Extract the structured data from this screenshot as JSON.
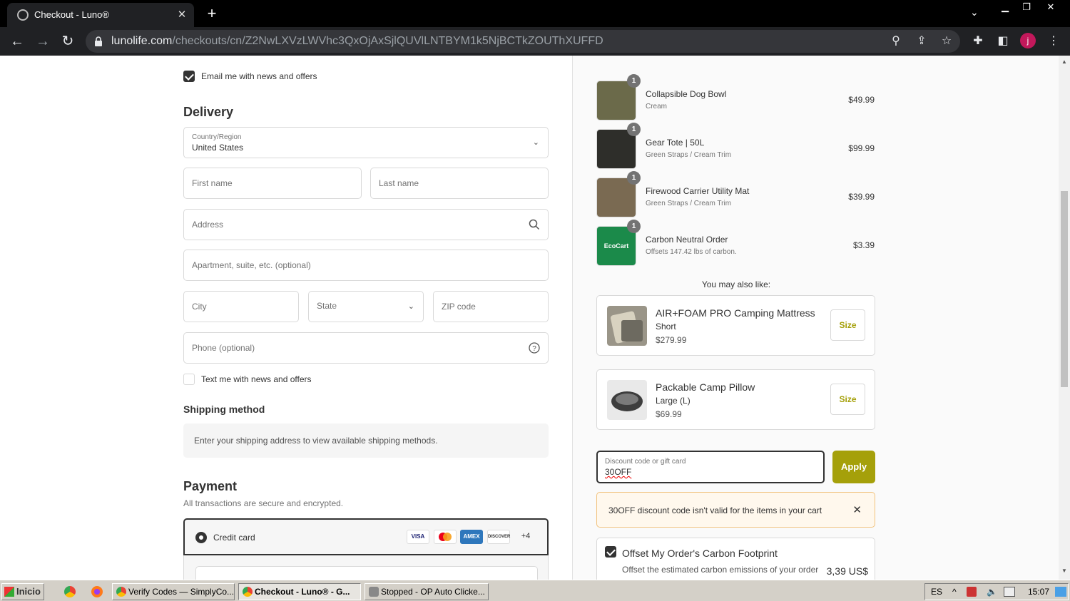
{
  "browser": {
    "tab_title": "Checkout - Luno®",
    "url_domain": "lunolife.com",
    "url_path": "/checkouts/cn/Z2NwLXVzLWVhc3QxOjAxSjlQUVlLNTBYM1k5NjBCTkZOUThXUFFD",
    "profile_initial": "j"
  },
  "contact": {
    "email_opt_in_label": "Email me with news and offers",
    "email_opt_in_checked": true
  },
  "delivery": {
    "title": "Delivery",
    "country_label": "Country/Region",
    "country_value": "United States",
    "first_name_placeholder": "First name",
    "last_name_placeholder": "Last name",
    "address_placeholder": "Address",
    "apartment_placeholder": "Apartment, suite, etc. (optional)",
    "city_placeholder": "City",
    "state_placeholder": "State",
    "zip_placeholder": "ZIP code",
    "phone_placeholder": "Phone (optional)",
    "sms_opt_in_label": "Text me with news and offers",
    "sms_opt_in_checked": false
  },
  "shipping": {
    "title": "Shipping method",
    "message": "Enter your shipping address to view available shipping methods."
  },
  "payment": {
    "title": "Payment",
    "subtitle": "All transactions are secure and encrypted.",
    "method_label": "Credit card",
    "card_brands": [
      "VISA",
      "MC",
      "AMEX",
      "DISCOVER"
    ],
    "more_brands": "+4"
  },
  "order": {
    "items": [
      {
        "qty": "1",
        "name": "Collapsible Dog Bowl",
        "variant": "Cream",
        "price": "$49.99",
        "thumb_color": "#6b6a4a"
      },
      {
        "qty": "1",
        "name": "Gear Tote | 50L",
        "variant": "Green Straps / Cream Trim",
        "price": "$99.99",
        "thumb_color": "#2e2e2a"
      },
      {
        "qty": "1",
        "name": "Firewood Carrier Utility Mat",
        "variant": "Green Straps / Cream Trim",
        "price": "$39.99",
        "thumb_color": "#7a6a52"
      },
      {
        "qty": "1",
        "name": "Carbon Neutral Order",
        "variant": "Offsets 147.42 lbs of carbon.",
        "price": "$3.39",
        "thumb_color": "#1b8a4a",
        "thumb_text": "EcoCart"
      }
    ],
    "upsell_heading": "You may also like:",
    "upsells": [
      {
        "name": "AIR+FOAM PRO Camping Mattress",
        "variant": "Short",
        "price": "$279.99",
        "button": "Size"
      },
      {
        "name": "Packable Camp Pillow",
        "variant": "Large (L)",
        "price": "$69.99",
        "button": "Size"
      }
    ],
    "discount_label": "Discount code or gift card",
    "discount_value": "30OFF",
    "apply_label": "Apply",
    "error_message": "30OFF discount code isn't valid for the items in your cart",
    "offset_title": "Offset My Order's Carbon Footprint",
    "offset_subtitle": "Offset the estimated carbon emissions of your order",
    "offset_price": "3,39 US$",
    "offset_checked": true
  },
  "taskbar": {
    "start_label": "Inicio",
    "items": [
      "Verify Codes — SimplyCo...",
      "Checkout - Luno® - G...",
      "Stopped - OP Auto Clicke..."
    ],
    "language": "ES",
    "clock": "15:07"
  },
  "colors": {
    "accent": "#a5a00a",
    "chrome_dark": "#202124"
  }
}
